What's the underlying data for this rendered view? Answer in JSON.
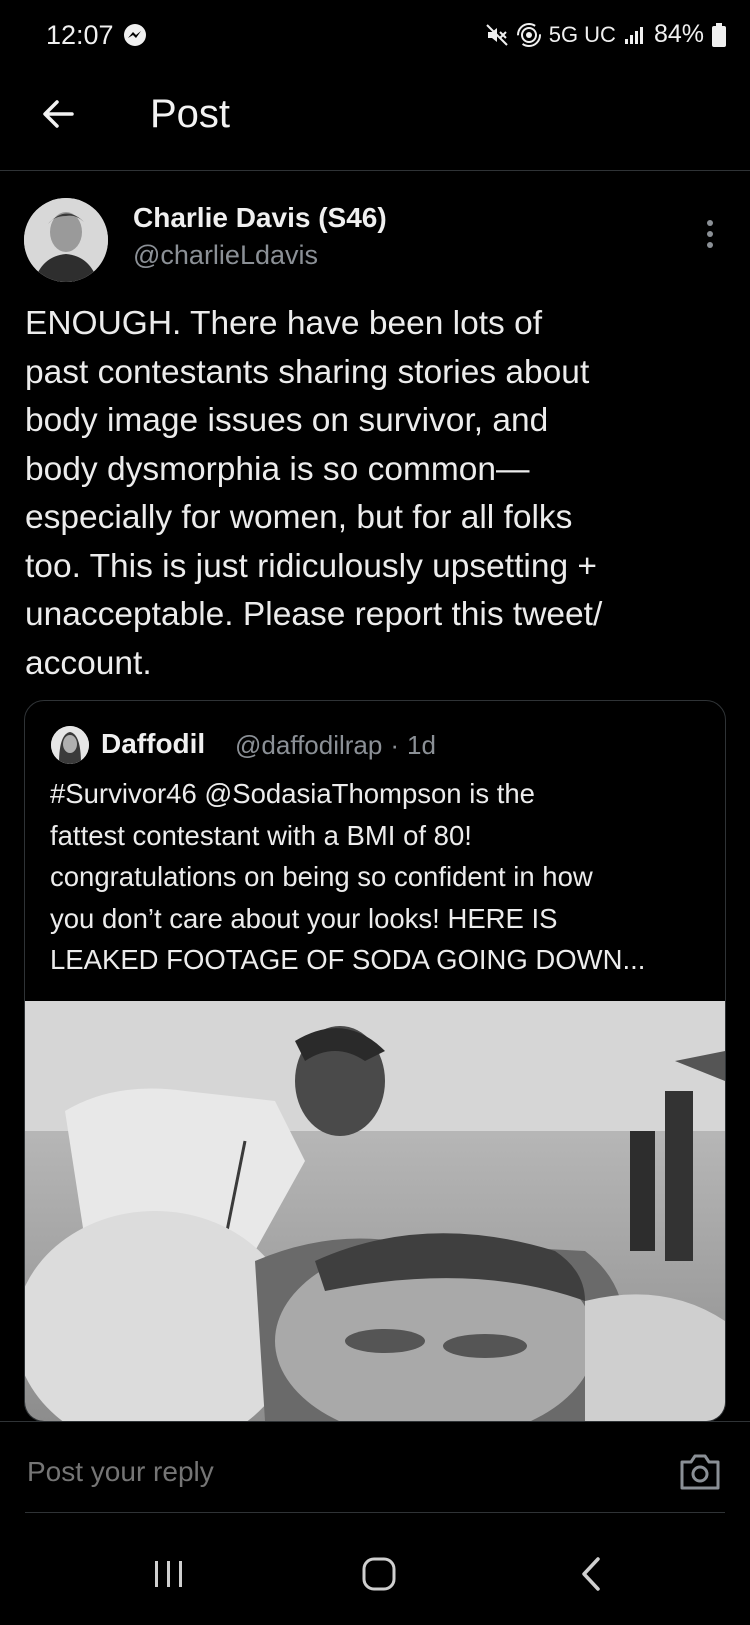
{
  "status_bar": {
    "time": "12:07",
    "network": "5G UC",
    "battery": "84%"
  },
  "header": {
    "title": "Post"
  },
  "post": {
    "author_name": "Charlie Davis (S46)",
    "author_handle": "@charlieLdavis",
    "text": "ENOUGH. There have been lots of\npast contestants sharing stories about\nbody image issues on survivor, and\nbody dysmorphia is so common—\nespecially for women, but for all folks\ntoo. This is just ridiculously upsetting  +\nunacceptable. Please report this tweet/\naccount."
  },
  "quote": {
    "author_name": "Daffodil",
    "author_handle": "@daffodilrap",
    "separator": "·",
    "time": "1d",
    "text": "#Survivor46 @SodasiaThompson is the\nfattest contestant with a BMI of 80!\ncongratulations on being so confident in how\nyou don’t care about your looks! HERE IS\nLEAKED FOOTAGE OF SODA GOING DOWN..."
  },
  "reply": {
    "placeholder": "Post your reply"
  },
  "icons": {
    "back": "arrow-left-icon",
    "more": "vertical-ellipsis-icon",
    "camera": "camera-icon",
    "messenger": "messenger-icon",
    "mute": "mute-icon",
    "hotspot": "hotspot-icon",
    "signal": "signal-icon",
    "battery": "battery-icon"
  },
  "colors": {
    "background": "#000000",
    "text": "#e7e9ea",
    "secondary_text": "#8b9096",
    "divider": "#2f3336"
  }
}
